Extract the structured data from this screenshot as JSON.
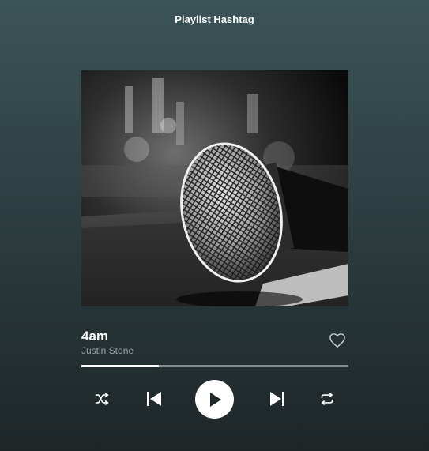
{
  "header": {
    "playlist_title": "Playlist Hashtag"
  },
  "album": {
    "art_icon": "microphone-photo"
  },
  "track": {
    "title": "4am",
    "artist": "Justin Stone",
    "favorite_icon": "heart-outline-icon",
    "progress_fraction": 0.29
  },
  "controls": {
    "shuffle_icon": "shuffle-icon",
    "previous_icon": "skip-previous-icon",
    "play_icon": "play-icon",
    "next_icon": "skip-next-icon",
    "repeat_icon": "repeat-icon"
  },
  "colors": {
    "accent": "#ffffff",
    "muted_text": "#9aa4a6",
    "track_bg": "#7f8a8c"
  }
}
